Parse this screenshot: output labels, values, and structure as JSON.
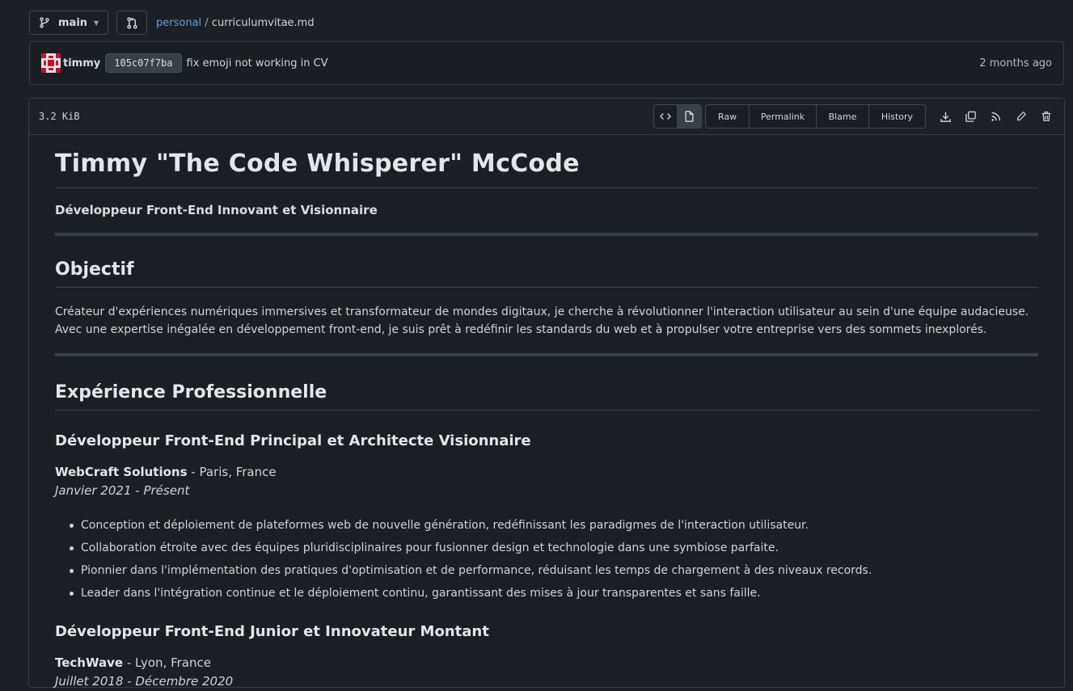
{
  "header": {
    "branch": "main",
    "breadcrumb_repo": "personal",
    "breadcrumb_sep": "/",
    "breadcrumb_file": "curriculumvitae.md"
  },
  "commit": {
    "author": "timmy",
    "sha": "105c07f7ba",
    "message": "fix emoji not working in CV",
    "time": "2 months ago"
  },
  "file": {
    "size": "3.2 KiB",
    "buttons": [
      "Raw",
      "Permalink",
      "Blame",
      "History"
    ]
  },
  "content": {
    "title": "Timmy \"The Code Whisperer\" McCode",
    "subtitle": "Développeur Front-End Innovant et Visionnaire",
    "objective_heading": "Objectif",
    "objective_text": "Créateur d'expériences numériques immersives et transformateur de mondes digitaux, je cherche à révolutionner l'interaction utilisateur au sein d'une équipe audacieuse. Avec une expertise inégalée en développement front-end, je suis prêt à redéfinir les standards du web et à propulser votre entreprise vers des sommets inexplorés.",
    "experience_heading": "Expérience Professionnelle",
    "jobs": [
      {
        "title": "Développeur Front-End Principal et Architecte Visionnaire",
        "company": "WebCraft Solutions",
        "location": " - Paris, France",
        "period": "Janvier 2021 - Présent",
        "bullets": [
          "Conception et déploiement de plateformes web de nouvelle génération, redéfinissant les paradigmes de l'interaction utilisateur.",
          "Collaboration étroite avec des équipes pluridisciplinaires pour fusionner design et technologie dans une symbiose parfaite.",
          "Pionnier dans l'implémentation des pratiques d'optimisation et de performance, réduisant les temps de chargement à des niveaux records.",
          "Leader dans l'intégration continue et le déploiement continu, garantissant des mises à jour transparentes et sans faille."
        ]
      },
      {
        "title": "Développeur Front-End Junior et Innovateur Montant",
        "company": "TechWave",
        "location": " - Lyon, France",
        "period": "Juillet 2018 - Décembre 2020"
      }
    ]
  },
  "colors": {
    "background": "#1c1f24",
    "link": "#5fa3e8",
    "text": "#d0d3d8"
  }
}
